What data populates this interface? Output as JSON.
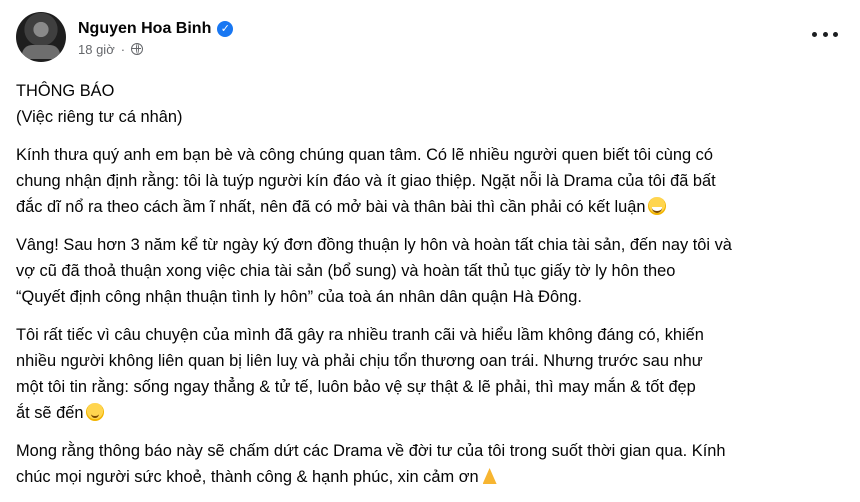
{
  "author": {
    "name": "Nguyen Hoa Binh",
    "timestamp": "18 giờ",
    "separator": "·",
    "verified_badge_icon": "verified-check-icon",
    "privacy_icon": "globe-icon"
  },
  "post": {
    "title": "THÔNG BÁO",
    "subtitle": "(Việc riêng tư cá nhân)",
    "paragraphs": [
      {
        "lines": [
          "Kính thưa quý anh em bạn bè và công chúng quan tâm. Có lẽ nhiều người quen biết tôi cùng có",
          "chung nhận định rằng: tôi là tuýp người kín đáo và ít giao thiệp. Ngặt nỗi là Drama của tôi đã bất",
          "đắc dĩ nổ ra theo cách ầm ĩ nhất, nên đã có mở bài và thân bài thì cần phải có kết luận"
        ]
      },
      {
        "lines": [
          "Vâng! Sau hơn 3 năm kể từ ngày ký đơn đồng thuận ly hôn và hoàn tất chia tài sản, đến nay tôi và",
          "vợ cũ đã thoả thuận xong việc chia tài sản (bổ sung) và hoàn tất thủ tục giấy tờ ly hôn theo",
          "“Quyết định công nhận thuận tình ly hôn” của toà án nhân dân quận Hà Đông."
        ]
      },
      {
        "lines": [
          "Tôi rất tiếc vì câu chuyện của mình đã gây ra nhiều tranh cãi và hiểu lầm không đáng có, khiến",
          "nhiều người không liên quan bị liên luỵ và phải chịu tổn thương oan trái. Nhưng trước sau như",
          "một tôi tin rằng: sống ngay thẳng & tử tế, luôn bảo vệ sự thật & lẽ phải, thì may mắn & tốt đẹp",
          "ắt sẽ đến"
        ]
      },
      {
        "lines": [
          "Mong rằng thông báo này sẽ chấm dứt các Drama về đời tư của tôi trong suốt thời gian qua. Kính",
          "chúc mọi người sức khoẻ, thành công & hạnh phúc, xin cảm ơn"
        ]
      }
    ],
    "emoji_icons": [
      "grinning-sweat-emoji-icon",
      "smiling-face-emoji-icon",
      "praying-hands-emoji-icon"
    ]
  },
  "ui": {
    "menu_icon": "more-options-icon",
    "verified_color": "#1877f2",
    "meta_text_color": "#65676b"
  }
}
